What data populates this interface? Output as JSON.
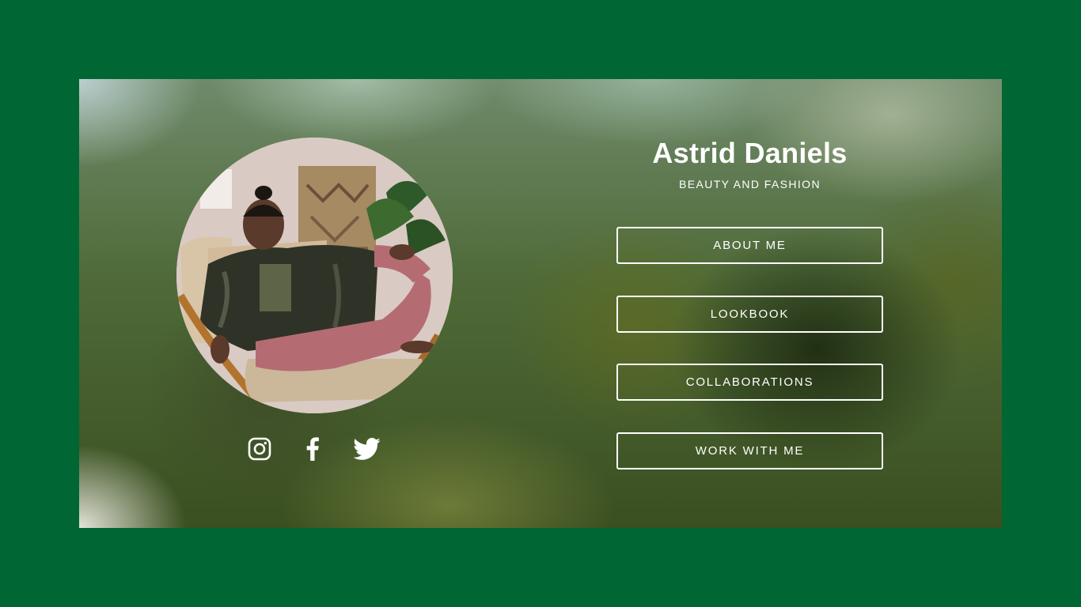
{
  "profile": {
    "name": "Astrid Daniels",
    "tagline": "BEAUTY AND FASHION"
  },
  "social": [
    {
      "icon": "instagram-icon"
    },
    {
      "icon": "facebook-icon"
    },
    {
      "icon": "twitter-icon"
    }
  ],
  "nav": {
    "buttons": [
      {
        "label": "ABOUT ME"
      },
      {
        "label": "LOOKBOOK"
      },
      {
        "label": "COLLABORATIONS"
      },
      {
        "label": "WORK WITH ME"
      }
    ]
  },
  "colors": {
    "page_background": "#006633",
    "text": "#ffffff",
    "button_border": "#ffffff"
  }
}
